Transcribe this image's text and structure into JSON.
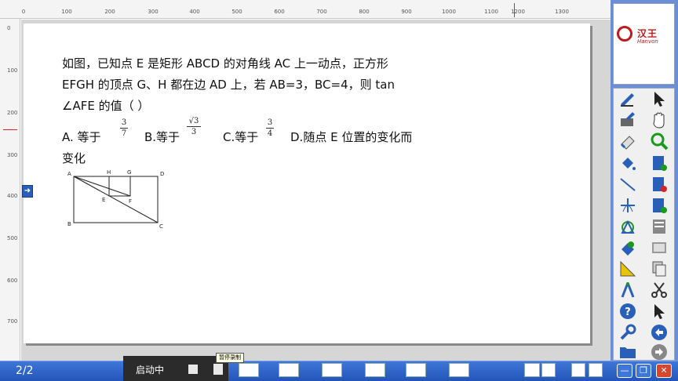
{
  "ruler": {
    "top_ticks": [
      "0",
      "100",
      "200",
      "300",
      "400",
      "500",
      "600",
      "700",
      "800",
      "900",
      "1000",
      "1100",
      "1200",
      "1300"
    ],
    "left_ticks": [
      "0",
      "100",
      "200",
      "300",
      "400",
      "500",
      "600",
      "700"
    ]
  },
  "question": {
    "line1": "如图，已知点 E 是矩形 ABCD 的对角线 AC 上一动点，正方形",
    "line2": "EFGH 的顶点 G、H 都在边 AD 上，若 AB=3，BC=4，则 tan",
    "line3": "∠AFE 的值（      ）",
    "option_a": "A.    等于",
    "option_a_num": "3",
    "option_a_den": "7",
    "option_b": "B.等于",
    "option_b_num": "√3",
    "option_b_den": "3",
    "option_c": "C.等于",
    "option_c_num": "3",
    "option_c_den": "4",
    "option_d": "D.随点  E  位置的变化而",
    "line_last": "变化"
  },
  "figure": {
    "labels": {
      "A": "A",
      "H": "H",
      "G": "G",
      "D": "D",
      "E": "E",
      "F": "F",
      "B": "B",
      "C": "C"
    }
  },
  "logo": {
    "text": "汉王",
    "sub": "Hanvon"
  },
  "status": {
    "page_counter": "2/2",
    "recording_label": "启动中",
    "tooltip": "暂停录制"
  },
  "window_buttons": {
    "minimize": "—",
    "restore": "❐",
    "close": "✕"
  },
  "colors": {
    "toolbar_blue": "#6c8fd4",
    "taskbar_blue": "#2355b8",
    "logo_red": "#c01a1a"
  }
}
